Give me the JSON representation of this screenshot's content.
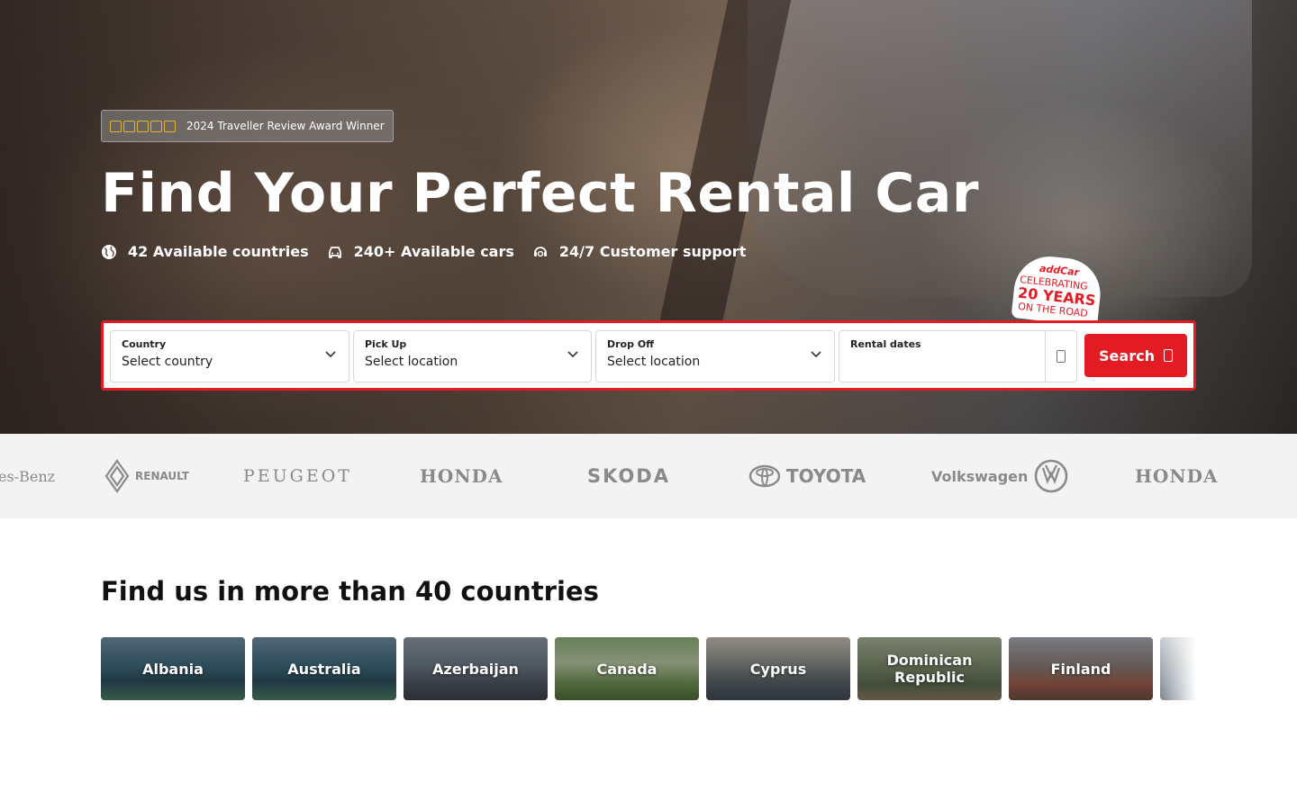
{
  "hero": {
    "award_text": "2024 Traveller Review Award Winner",
    "award_rating_stars": 5,
    "title": "Find Your Perfect Rental Car",
    "features": [
      {
        "icon": "globe-icon",
        "label": "42 Available countries"
      },
      {
        "icon": "car-icon",
        "label": "240+ Available cars"
      },
      {
        "icon": "support-icon",
        "label": "24/7 Customer support"
      }
    ],
    "badge": {
      "brand": "addCar",
      "line1": "CELEBRATING",
      "line2": "20 YEARS",
      "line3": "ON THE ROAD"
    }
  },
  "search": {
    "country": {
      "label": "Country",
      "value": "Select country"
    },
    "pickup": {
      "label": "Pick Up",
      "value": "Select location"
    },
    "dropoff": {
      "label": "Drop Off",
      "value": "Select location"
    },
    "dates": {
      "label": "Rental dates",
      "value": ""
    },
    "button_label": "Search"
  },
  "brands": [
    "es-Benz",
    "RENAULT",
    "PEUGEOT",
    "HONDA",
    "SKODA",
    "TOYOTA",
    "Volkswagen",
    "HONDA"
  ],
  "countries": {
    "title": "Find us in more than 40 countries",
    "items": [
      "Albania",
      "Australia",
      "Azerbaijan",
      "Canada",
      "Cyprus",
      "Dominican Republic",
      "Finland",
      ""
    ]
  },
  "colors": {
    "accent": "#e31b23",
    "brand_strip_bg": "#f3f3f3",
    "star": "#e2b23a"
  }
}
